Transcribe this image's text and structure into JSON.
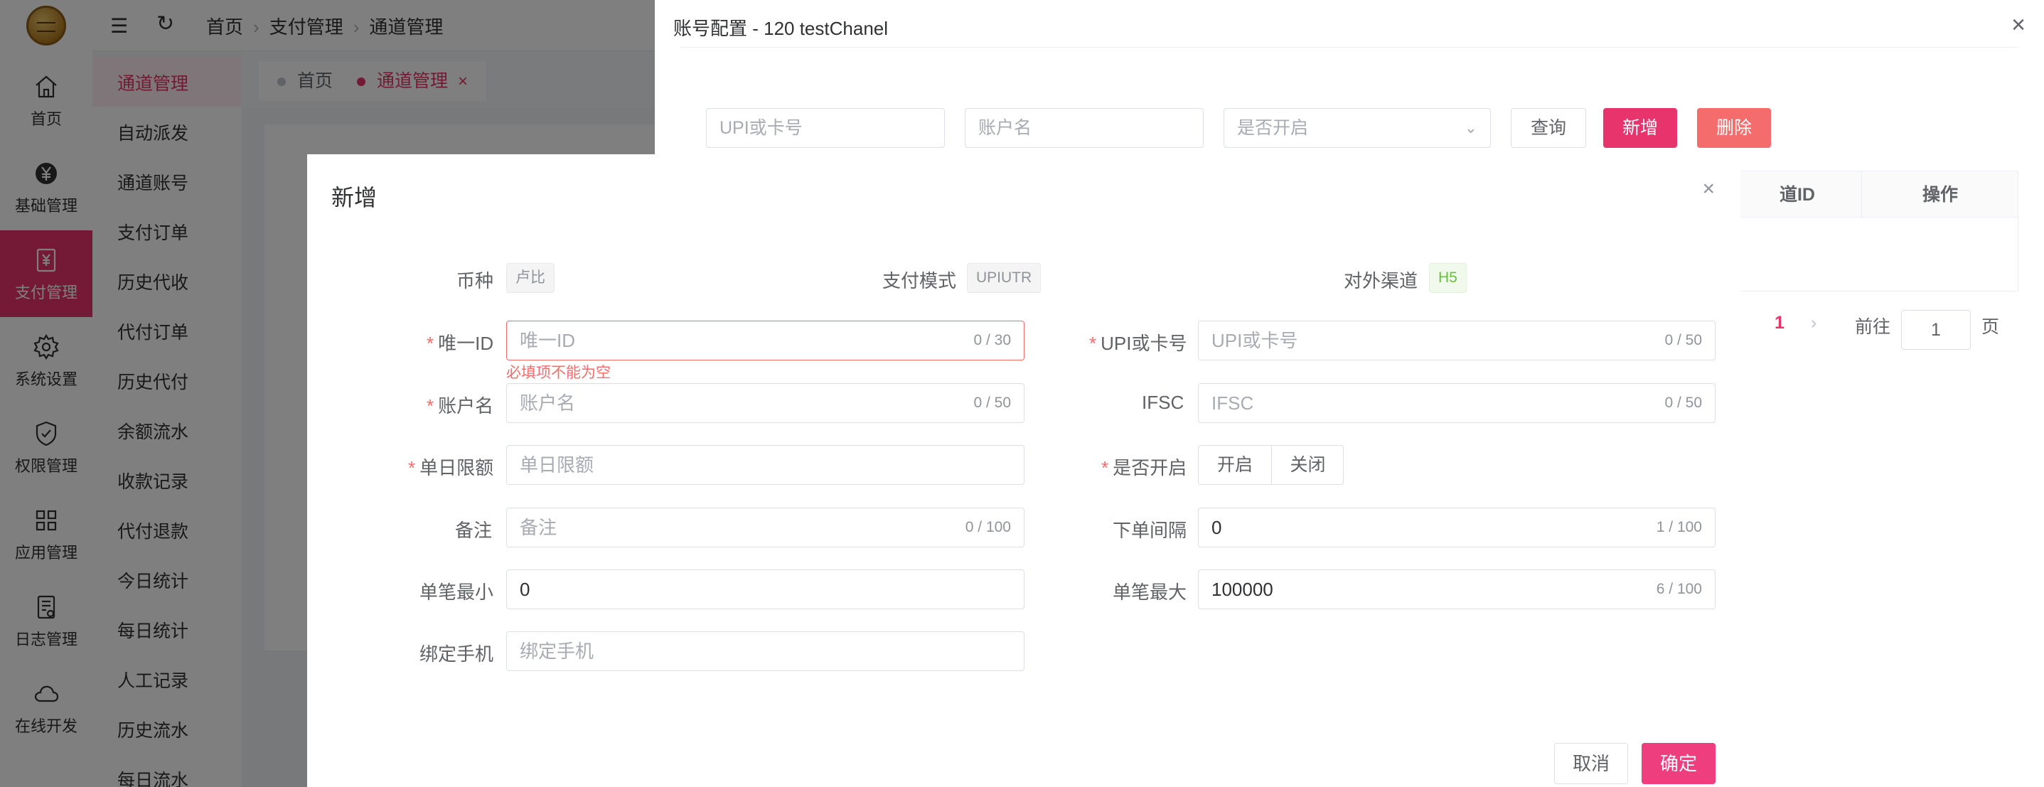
{
  "sidebar": {
    "items": [
      {
        "label": "首页",
        "icon": "home-icon"
      },
      {
        "label": "基础管理",
        "icon": "yen-coin-icon"
      },
      {
        "label": "支付管理",
        "icon": "yen-document-icon"
      },
      {
        "label": "系统设置",
        "icon": "gear-icon"
      },
      {
        "label": "权限管理",
        "icon": "shield-check-icon"
      },
      {
        "label": "应用管理",
        "icon": "grid-icon"
      },
      {
        "label": "日志管理",
        "icon": "log-icon"
      },
      {
        "label": "在线开发",
        "icon": "cloud-icon"
      }
    ],
    "active_index": 2
  },
  "submenu": {
    "items": [
      "通道管理",
      "自动派发",
      "通道账号",
      "支付订单",
      "历史代收",
      "代付订单",
      "历史代付",
      "余额流水",
      "收款记录",
      "代付退款",
      "今日统计",
      "每日统计",
      "人工记录",
      "历史流水",
      "每日流水"
    ],
    "active_index": 0
  },
  "breadcrumb": {
    "items": [
      "首页",
      "支付管理",
      "通道管理"
    ]
  },
  "tabs": [
    {
      "label": "首页",
      "active": false
    },
    {
      "label": "通道管理",
      "active": true,
      "close": "×"
    }
  ],
  "drawer": {
    "title": "账号配置 - 120 testChanel",
    "close": "×",
    "search": {
      "upi_placeholder": "UPI或卡号",
      "account_placeholder": "账户名",
      "enabled_placeholder": "是否开启",
      "query_label": "查询",
      "add_label": "新增",
      "delete_label": "删除"
    },
    "table_headers": [
      "道ID",
      "操作"
    ],
    "pager": {
      "current": "1",
      "goto_label": "前往",
      "page_input": "1",
      "page_suffix": "页"
    }
  },
  "modal": {
    "title": "新增",
    "close": "×",
    "info": {
      "currency_label": "币种",
      "currency_value": "卢比",
      "paymode_label": "支付模式",
      "paymode_value": "UPIUTR",
      "channel_label": "对外渠道",
      "channel_value": "H5"
    },
    "fields": {
      "uid": {
        "label": "唯一ID",
        "required": "*",
        "placeholder": "唯一ID",
        "count": "0 / 30",
        "error": "必填项不能为空"
      },
      "upi": {
        "label": "UPI或卡号",
        "required": "*",
        "placeholder": "UPI或卡号",
        "count": "0 / 50"
      },
      "account": {
        "label": "账户名",
        "required": "*",
        "placeholder": "账户名",
        "count": "0 / 50"
      },
      "ifsc": {
        "label": "IFSC",
        "placeholder": "IFSC",
        "count": "0 / 50"
      },
      "daily_limit": {
        "label": "单日限额",
        "required": "*",
        "placeholder": "单日限额"
      },
      "enabled": {
        "label": "是否开启",
        "required": "*",
        "on": "开启",
        "off": "关闭"
      },
      "remark": {
        "label": "备注",
        "placeholder": "备注",
        "count": "0 / 100"
      },
      "interval": {
        "label": "下单间隔",
        "value": "0",
        "count": "1 / 100"
      },
      "min": {
        "label": "单笔最小",
        "value": "0"
      },
      "max": {
        "label": "单笔最大",
        "value": "100000",
        "count": "6 / 100"
      },
      "phone": {
        "label": "绑定手机",
        "placeholder": "绑定手机"
      }
    },
    "cancel_label": "取消",
    "confirm_label": "确定"
  },
  "colors": {
    "accent": "#e8346c",
    "danger": "#f56c6c"
  }
}
